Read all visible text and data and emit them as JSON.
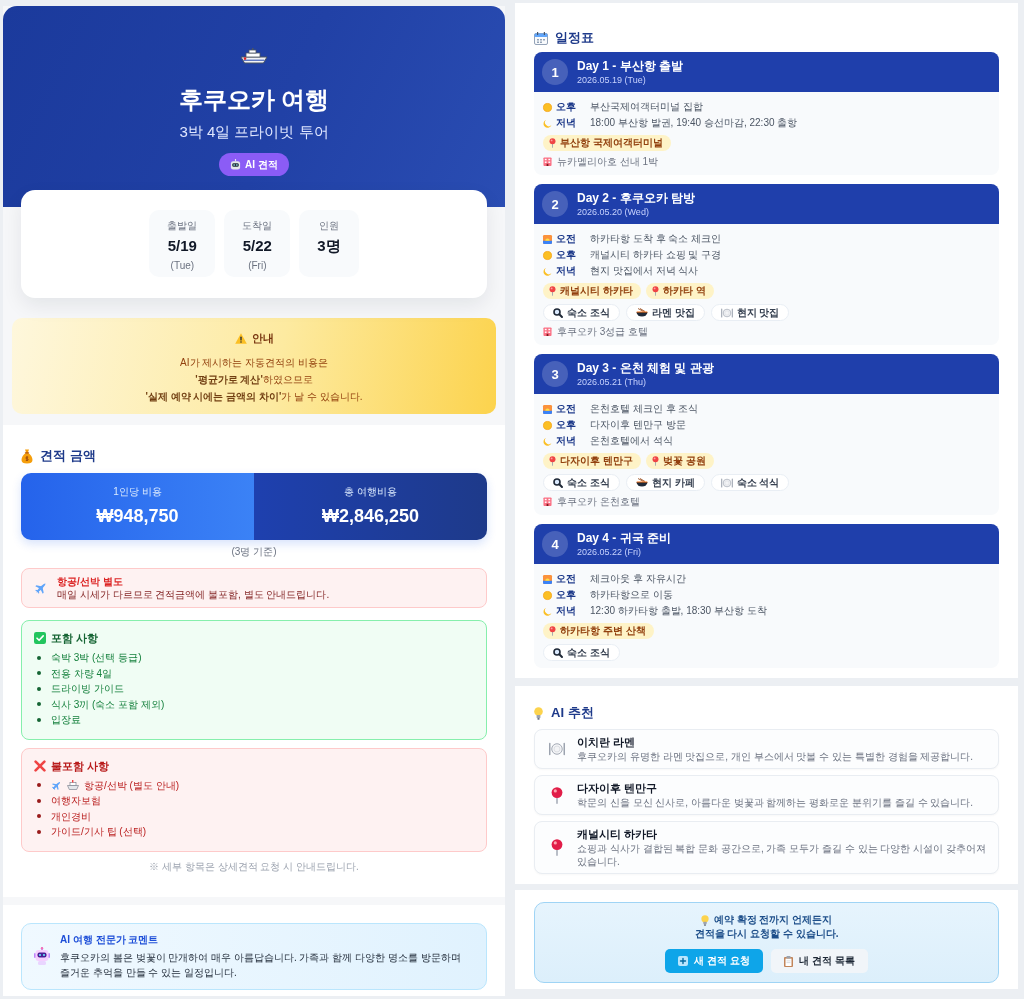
{
  "header": {
    "title": "후쿠오카 여행",
    "subtitle": "3박 4일 프라이빗 투어",
    "badge": "AI 견적"
  },
  "trip_info": [
    {
      "label": "출발일",
      "value": "5/19",
      "weekday": "(Tue)"
    },
    {
      "label": "도착일",
      "value": "5/22",
      "weekday": "(Fri)"
    },
    {
      "label": "인원",
      "value": "3명"
    }
  ],
  "notice": {
    "title": "안내",
    "lines": [
      "AI가 제시하는 자동견적의 비용은",
      "**'평균가로 계산'**하였으므로",
      "**'실제 예약 시에는 금액의 차이'**가 날 수 있습니다."
    ]
  },
  "quote": {
    "title": "견적 금액",
    "prices": [
      {
        "label": "1인당 비용",
        "value": "₩948,750"
      },
      {
        "label": "총 여행비용",
        "value": "₩2,846,250"
      }
    ],
    "basis": "(3명 기준)",
    "separate_notice": {
      "title": "항공/선박 별도",
      "text": "매일 시세가 다르므로 견적금액에 불포함, 별도 안내드립니다."
    },
    "included": {
      "title": "포함 사항",
      "items": [
        "숙박 3박 (선택 등급)",
        "전용 차량 4일",
        "드라이빙 가이드",
        "식사 3끼 (숙소 포함 제외)",
        "입장료"
      ]
    },
    "excluded": {
      "title": "불포함 사항",
      "items": [
        {
          "kind": "transport",
          "text": "항공/선박 (별도 안내)"
        },
        {
          "kind": "plain",
          "text": "여행자보험"
        },
        {
          "kind": "plain",
          "text": "개인경비"
        },
        {
          "kind": "plain",
          "text": "가이드/기사 팁 (선택)"
        }
      ]
    },
    "footnote": "※ 세부 항목은 상세견적 요청 시 안내드립니다."
  },
  "ai_comment": {
    "title": "AI 여행 전문가 코멘트",
    "text": "후쿠오카의 봄은 벚꽃이 만개하여 매우 아름답습니다. 가족과 함께 다양한 명소를 방문하며 즐거운 추억을 만들 수 있는 일정입니다."
  },
  "schedule": {
    "title": "일정표",
    "days": [
      {
        "number": "1",
        "title": "Day 1 - 부산항 출발",
        "date": "2026.05.19 (Tue)",
        "entries": [
          {
            "kind": "afternoon",
            "period": "오후",
            "text": "부산국제여객터미널 집합"
          },
          {
            "kind": "evening",
            "period": "저녁",
            "text": "18:00 부산항 발권, 19:40 승선마감, 22:30 출항"
          }
        ],
        "places": [
          "부산항 국제여객터미널"
        ],
        "lodging": "뉴카멜리아호 선내 1박"
      },
      {
        "number": "2",
        "title": "Day 2 - 후쿠오카 탐방",
        "date": "2026.05.20 (Wed)",
        "entries": [
          {
            "kind": "morning",
            "period": "오전",
            "text": "하카타항 도착 후 숙소 체크인"
          },
          {
            "kind": "afternoon",
            "period": "오후",
            "text": "캐널시티 하카타 쇼핑 및 구경"
          },
          {
            "kind": "evening",
            "period": "저녁",
            "text": "현지 맛집에서 저녁 식사"
          }
        ],
        "places": [
          "캐널시티 하카타",
          "하카타 역"
        ],
        "meals": [
          {
            "kind": "breakfast",
            "name": "숙소 조식"
          },
          {
            "kind": "lunch",
            "name": "라멘 맛집"
          },
          {
            "kind": "dinner",
            "name": "현지 맛집"
          }
        ],
        "lodging": "후쿠오카 3성급 호텔"
      },
      {
        "number": "3",
        "title": "Day 3 - 온천 체험 및 관광",
        "date": "2026.05.21 (Thu)",
        "entries": [
          {
            "kind": "morning",
            "period": "오전",
            "text": "온천호텔 체크인 후 조식"
          },
          {
            "kind": "afternoon",
            "period": "오후",
            "text": "다자이후 텐만구 방문"
          },
          {
            "kind": "evening",
            "period": "저녁",
            "text": "온천호텔에서 석식"
          }
        ],
        "places": [
          "다자이후 텐만구",
          "벚꽃 공원"
        ],
        "meals": [
          {
            "kind": "breakfast",
            "name": "숙소 조식"
          },
          {
            "kind": "lunch",
            "name": "현지 카페"
          },
          {
            "kind": "dinner",
            "name": "숙소 석식"
          }
        ],
        "lodging": "후쿠오카 온천호텔"
      },
      {
        "number": "4",
        "title": "Day 4 - 귀국 준비",
        "date": "2026.05.22 (Fri)",
        "entries": [
          {
            "kind": "morning",
            "period": "오전",
            "text": "체크아웃 후 자유시간"
          },
          {
            "kind": "afternoon",
            "period": "오후",
            "text": "하카타항으로 이동"
          },
          {
            "kind": "evening",
            "period": "저녁",
            "text": "12:30 하카타항 출발, 18:30 부산항 도착"
          }
        ],
        "places": [
          "하카타항 주변 산책"
        ],
        "meals": [
          {
            "kind": "breakfast",
            "name": "숙소 조식"
          }
        ]
      }
    ]
  },
  "recommendations": {
    "title": "AI 추천",
    "items": [
      {
        "kind": "food",
        "name": "이치란 라멘",
        "description": "후쿠오카의 유명한 라멘 맛집으로, 개인 부스에서 맛볼 수 있는 특별한 경험을 제공합니다."
      },
      {
        "kind": "place",
        "name": "다자이후 텐만구",
        "description": "학문의 신을 모신 신사로, 아름다운 벚꽃과 함께하는 평화로운 분위기를 즐길 수 있습니다."
      },
      {
        "kind": "place",
        "name": "캐널시티 하카타",
        "description": "쇼핑과 식사가 결합된 복합 문화 공간으로, 가족 모두가 즐길 수 있는 다양한 시설이 갖추어져 있습니다."
      }
    ]
  },
  "cta": {
    "message_lines": [
      "예약 확정 전까지 언제든지",
      "견적을 다시 요청할 수 있습니다."
    ],
    "buttons": [
      {
        "kind": "primary",
        "label": "새 견적 요청"
      },
      {
        "kind": "secondary",
        "label": "내 견적 목록"
      }
    ]
  }
}
